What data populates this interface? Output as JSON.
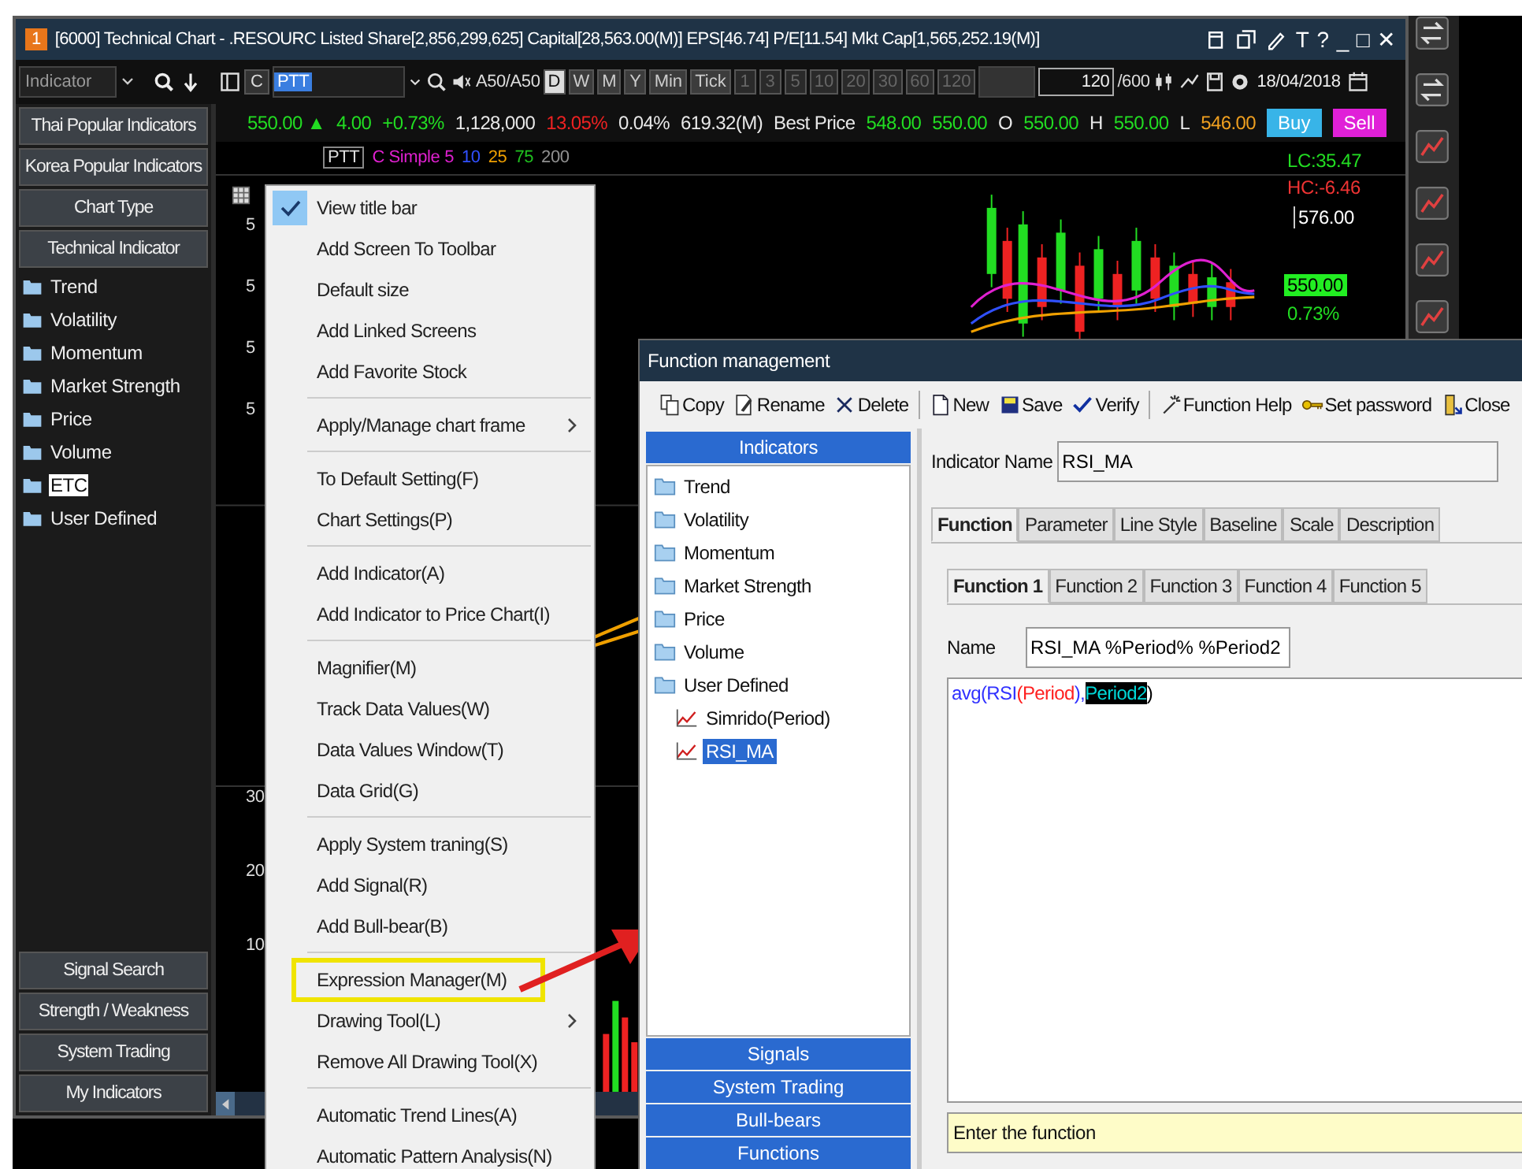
{
  "main_window": {
    "badge": "1",
    "title": "[6000] Technical Chart - .RESOURC Listed Share[2,856,299,625] Capital[28,563.00(M)] EPS[46.74] P/E[11.54] Mkt Cap[1,565,252.19(M)]",
    "window_controls": [
      "T",
      "?",
      "_",
      "□",
      "✕"
    ]
  },
  "toolbar": {
    "indicator_search": {
      "placeholder": "Indicator"
    },
    "chart_button": "C",
    "symbol": "PTT",
    "compare": "A50/A50",
    "periods": [
      {
        "label": "D",
        "selected": true
      },
      {
        "label": "W",
        "selected": false
      },
      {
        "label": "M",
        "selected": false
      },
      {
        "label": "Y",
        "selected": false
      },
      {
        "label": "Min",
        "selected": false
      },
      {
        "label": "Tick",
        "selected": false
      }
    ],
    "intervals": [
      {
        "label": "1",
        "disabled": true
      },
      {
        "label": "3",
        "disabled": true
      },
      {
        "label": "5",
        "disabled": true
      },
      {
        "label": "10",
        "disabled": true
      },
      {
        "label": "20",
        "disabled": true
      },
      {
        "label": "30",
        "disabled": true
      },
      {
        "label": "60",
        "disabled": true
      },
      {
        "label": "120",
        "disabled": true
      }
    ],
    "count": "120",
    "count_max": "/600",
    "date": "18/04/2018"
  },
  "quote": [
    {
      "text": "550.00 ▲",
      "color": "#22dd22"
    },
    {
      "text": "4.00",
      "color": "#22dd22"
    },
    {
      "text": "+0.73%",
      "color": "#22dd22"
    },
    {
      "text": "1,128,000",
      "color": "#e8e8e8"
    },
    {
      "text": "13.05%",
      "color": "#ee2222"
    },
    {
      "text": "0.04%",
      "color": "#e8e8e8"
    },
    {
      "text": "619.32(M)",
      "color": "#e8e8e8"
    },
    {
      "text": "Best Price",
      "color": "#e8e8e8"
    },
    {
      "text": "548.00",
      "color": "#22dd22"
    },
    {
      "text": "550.00",
      "color": "#22dd22"
    },
    {
      "text": "O",
      "color": "#e8e8e8"
    },
    {
      "text": "550.00",
      "color": "#22dd22"
    },
    {
      "text": "H",
      "color": "#e8e8e8"
    },
    {
      "text": "550.00",
      "color": "#22dd22"
    },
    {
      "text": "L",
      "color": "#e8e8e8"
    },
    {
      "text": "546.00",
      "color": "#f0a020"
    }
  ],
  "trade_buttons": [
    {
      "label": "Buy",
      "color": "#38b4e8"
    },
    {
      "label": "Sell",
      "color": "#e020d8"
    }
  ],
  "sidebar": {
    "top_buttons": [
      "Thai Popular Indicators",
      "Korea Popular Indicators",
      "Chart Type",
      "Technical Indicator"
    ],
    "folders": [
      {
        "label": "Trend",
        "selected": false
      },
      {
        "label": "Volatility",
        "selected": false
      },
      {
        "label": "Momentum",
        "selected": false
      },
      {
        "label": "Market Strength",
        "selected": false
      },
      {
        "label": "Price",
        "selected": false
      },
      {
        "label": "Volume",
        "selected": false
      },
      {
        "label": "ETC",
        "selected": true
      },
      {
        "label": "User Defined",
        "selected": false
      }
    ],
    "bottom_buttons": [
      "Signal Search",
      "Strength / Weakness",
      "System Trading",
      "My Indicators"
    ]
  },
  "chart": {
    "symbol": "PTT",
    "legend": [
      {
        "text": "C Simple 5",
        "color": "#e020d0"
      },
      {
        "text": "10",
        "color": "#3050ff"
      },
      {
        "text": "25",
        "color": "#f0a000"
      },
      {
        "text": "75",
        "color": "#20c020"
      },
      {
        "text": "200",
        "color": "#909090"
      }
    ],
    "axis_labels": [
      "5",
      "5",
      "5",
      "5",
      "30",
      "20",
      "10"
    ],
    "right_labels": [
      {
        "text": "LC:35.47",
        "kind": "green"
      },
      {
        "text": "HC:-6.46",
        "kind": "red"
      },
      {
        "text": "576.00",
        "kind": "price"
      },
      {
        "text": "550.00",
        "kind": "current"
      },
      {
        "text": "0.73%",
        "kind": "green"
      }
    ]
  },
  "context_menu": {
    "groups": [
      [
        {
          "label": "View title bar",
          "checked": true,
          "submenu": false,
          "highlighted": false
        },
        {
          "label": "Add Screen To Toolbar",
          "checked": false,
          "submenu": false,
          "highlighted": false
        },
        {
          "label": "Default size",
          "checked": false,
          "submenu": false,
          "highlighted": false
        },
        {
          "label": "Add Linked Screens",
          "checked": false,
          "submenu": false,
          "highlighted": false
        },
        {
          "label": "Add Favorite Stock",
          "checked": false,
          "submenu": false,
          "highlighted": false
        }
      ],
      [
        {
          "label": "Apply/Manage chart frame",
          "checked": false,
          "submenu": true,
          "highlighted": false
        }
      ],
      [
        {
          "label": "To Default Setting(F)",
          "checked": false,
          "submenu": false,
          "highlighted": false
        },
        {
          "label": "Chart Settings(P)",
          "checked": false,
          "submenu": false,
          "highlighted": false
        }
      ],
      [
        {
          "label": "Add Indicator(A)",
          "checked": false,
          "submenu": false,
          "highlighted": false
        },
        {
          "label": "Add Indicator to Price Chart(I)",
          "checked": false,
          "submenu": false,
          "highlighted": false
        }
      ],
      [
        {
          "label": "Magnifier(M)",
          "checked": false,
          "submenu": false,
          "highlighted": false
        },
        {
          "label": "Track Data Values(W)",
          "checked": false,
          "submenu": false,
          "highlighted": false
        },
        {
          "label": "Data Values Window(T)",
          "checked": false,
          "submenu": false,
          "highlighted": false
        },
        {
          "label": "Data Grid(G)",
          "checked": false,
          "submenu": false,
          "highlighted": false
        }
      ],
      [
        {
          "label": "Apply System traning(S)",
          "checked": false,
          "submenu": false,
          "highlighted": false
        },
        {
          "label": "Add Signal(R)",
          "checked": false,
          "submenu": false,
          "highlighted": false
        },
        {
          "label": "Add Bull-bear(B)",
          "checked": false,
          "submenu": false,
          "highlighted": false
        }
      ],
      [
        {
          "label": "Expression Manager(M)",
          "checked": false,
          "submenu": false,
          "highlighted": true
        },
        {
          "label": "Drawing Tool(L)",
          "checked": false,
          "submenu": true,
          "highlighted": false
        },
        {
          "label": "Remove All Drawing Tool(X)",
          "checked": false,
          "submenu": false,
          "highlighted": false
        }
      ],
      [
        {
          "label": "Automatic Trend Lines(A)",
          "checked": false,
          "submenu": false,
          "highlighted": false
        },
        {
          "label": "Automatic Pattern Analysis(N)",
          "checked": false,
          "submenu": false,
          "highlighted": false
        }
      ]
    ]
  },
  "dialog": {
    "title": "Function management",
    "toolbar": [
      [
        "Copy",
        "Rename",
        "Delete"
      ],
      [
        "New",
        "Save",
        "Verify"
      ],
      [
        "Function Help",
        "Set password",
        "Close"
      ]
    ],
    "panel_title": "Indicators",
    "tree": [
      {
        "label": "Trend",
        "selected": false
      },
      {
        "label": "Volatility",
        "selected": false
      },
      {
        "label": "Momentum",
        "selected": false
      },
      {
        "label": "Market Strength",
        "selected": false
      },
      {
        "label": "Price",
        "selected": false
      },
      {
        "label": "Volume",
        "selected": false
      },
      {
        "label": "User Defined",
        "selected": false,
        "children": [
          {
            "label": "Simrido(Period)",
            "selected": false
          },
          {
            "label": "RSI_MA",
            "selected": true
          }
        ]
      }
    ],
    "panel_buttons": [
      "Signals",
      "System Trading",
      "Bull-bears",
      "Functions"
    ],
    "indicator_name": {
      "label": "Indicator Name",
      "value": "RSI_MA"
    },
    "tabs": [
      {
        "label": "Function",
        "selected": true
      },
      {
        "label": "Parameter",
        "selected": false
      },
      {
        "label": "Line Style",
        "selected": false
      },
      {
        "label": "Baseline",
        "selected": false
      },
      {
        "label": "Scale",
        "selected": false
      },
      {
        "label": "Description",
        "selected": false
      }
    ],
    "sub_tabs": [
      {
        "label": "Function 1",
        "selected": true
      },
      {
        "label": "Function 2",
        "selected": false
      },
      {
        "label": "Function 3",
        "selected": false
      },
      {
        "label": "Function 4",
        "selected": false
      },
      {
        "label": "Function 5",
        "selected": false
      }
    ],
    "name_field": {
      "label": "Name",
      "value": "RSI_MA %Period% %Period2"
    },
    "code": [
      {
        "text": "avg(",
        "kind": "function",
        "selected": false
      },
      {
        "text": "RSI",
        "kind": "function",
        "selected": false
      },
      {
        "text": "(",
        "kind": "argument",
        "selected": false
      },
      {
        "text": "Period",
        "kind": "argument",
        "selected": false
      },
      {
        "text": "),",
        "kind": "function",
        "selected": false
      },
      {
        "text": "Period2",
        "kind": "parameter",
        "selected": true
      },
      {
        "text": ")",
        "kind": "plain",
        "selected": false
      }
    ],
    "hint": "Enter the function"
  }
}
